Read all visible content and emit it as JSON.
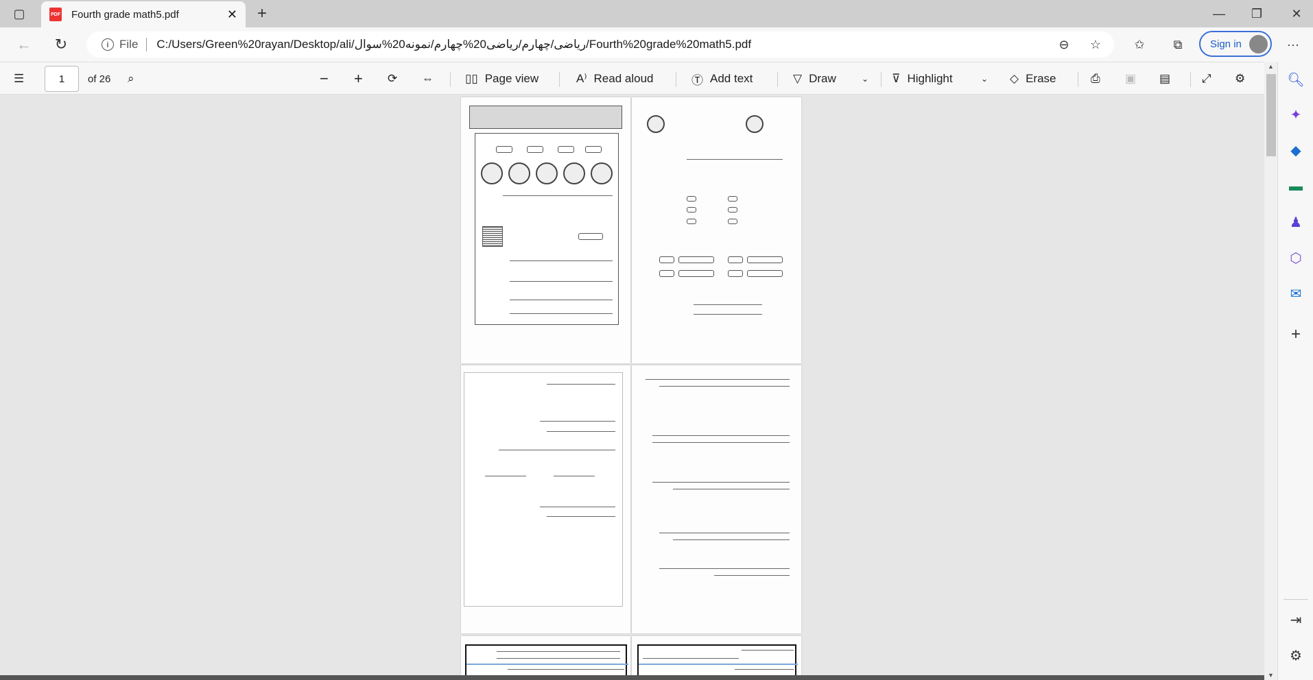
{
  "tab": {
    "title": "Fourth grade math5.pdf",
    "icon": "pdf-icon"
  },
  "address": {
    "scheme_label": "File",
    "url": "C:/Users/Green%20rayan/Desktop/ali/ریاضی/چهارم/ریاضی20%چهارم/نمونه20%سوال/Fourth%20grade%20math5.pdf"
  },
  "profile": {
    "sign_in": "Sign in"
  },
  "pdf_toolbar": {
    "page": "1",
    "of": "of 26",
    "page_view": "Page view",
    "read_aloud": "Read aloud",
    "add_text": "Add text",
    "draw": "Draw",
    "highlight": "Highlight",
    "erase": "Erase"
  },
  "sidebar": {
    "items": [
      "search",
      "copilot",
      "shopping",
      "tools",
      "games",
      "microsoft-365",
      "outlook",
      "add"
    ]
  }
}
